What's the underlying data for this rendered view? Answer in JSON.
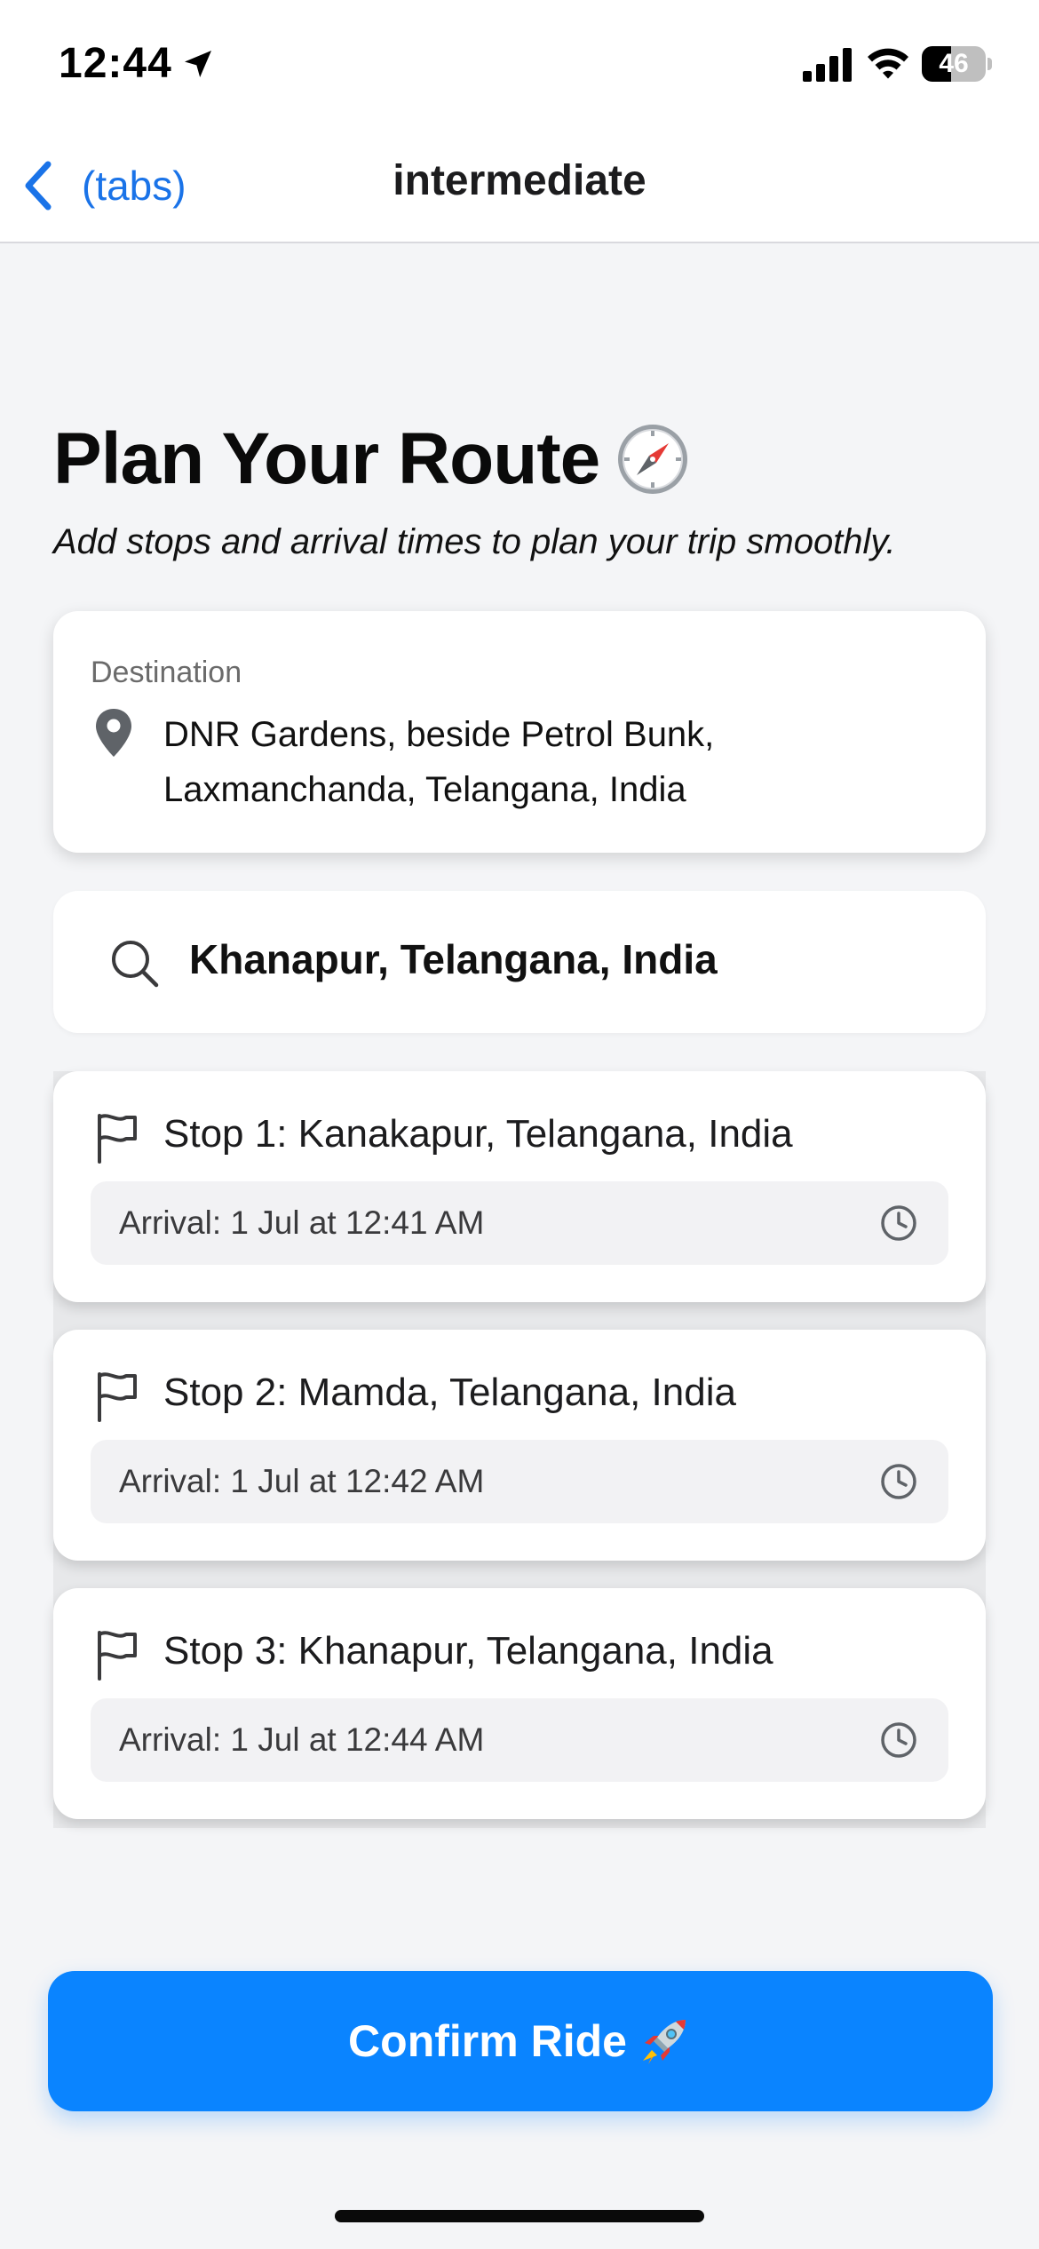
{
  "status_bar": {
    "time": "12:44",
    "battery_level": "46",
    "battery_fraction": 0.46,
    "icons": [
      "location-arrow-icon",
      "cellular-signal-icon",
      "wifi-icon",
      "battery-icon"
    ]
  },
  "nav": {
    "back_label": "(tabs)",
    "title": "intermediate",
    "back_icon": "chevron-left-icon"
  },
  "heading": {
    "title": "Plan Your Route",
    "title_icon": "compass-icon",
    "subtitle": "Add stops and arrival times to plan your trip smoothly."
  },
  "destination": {
    "label": "Destination",
    "icon": "map-pin-icon",
    "address": "DNR Gardens, beside Petrol Bunk, Laxmanchanda, Telangana, India"
  },
  "search": {
    "icon": "search-icon",
    "value": "Khanapur, Telangana, India"
  },
  "stops": [
    {
      "title": "Stop 1: Kanakapur, Telangana, India",
      "arrival": "Arrival: 1 Jul at 12:41 AM"
    },
    {
      "title": "Stop 2: Mamda, Telangana, India",
      "arrival": "Arrival: 1 Jul at 12:42 AM"
    },
    {
      "title": "Stop 3: Khanapur, Telangana, India",
      "arrival": "Arrival: 1 Jul at 12:44 AM"
    }
  ],
  "confirm": {
    "label": "Confirm Ride",
    "icon": "rocket-icon"
  },
  "colors": {
    "accent": "#0a84ff",
    "link": "#1a73e8",
    "background": "#f4f5f7",
    "card": "#ffffff"
  }
}
